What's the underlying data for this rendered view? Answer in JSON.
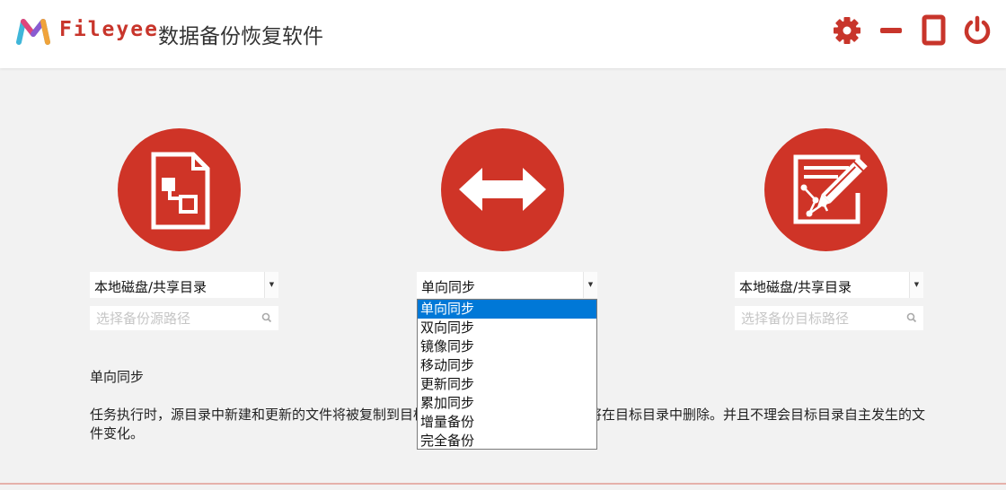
{
  "app": {
    "brand": "Fileyee",
    "title": "数据备份恢复软件"
  },
  "window_controls": {
    "settings": "gear-icon",
    "minimize": "minimize-icon",
    "maximize": "maximize-icon",
    "power": "power-icon"
  },
  "source": {
    "type_value": "本地磁盘/共享目录",
    "path_placeholder": "选择备份源路径"
  },
  "mode": {
    "selected": "单向同步",
    "options": [
      "单向同步",
      "双向同步",
      "镜像同步",
      "移动同步",
      "更新同步",
      "累加同步",
      "增量备份",
      "完全备份"
    ]
  },
  "target": {
    "type_value": "本地磁盘/共享目录",
    "path_placeholder": "选择备份目标路径"
  },
  "description": {
    "title": "单向同步",
    "text": "任务执行时，源目录中新建和更新的文件将被复制到目标目录，源目录中删除的文件将在目标目录中删除。并且不理会目标目录自主发生的文件变化。"
  },
  "colors": {
    "accent": "#cf3427",
    "selection": "#0078d7"
  }
}
